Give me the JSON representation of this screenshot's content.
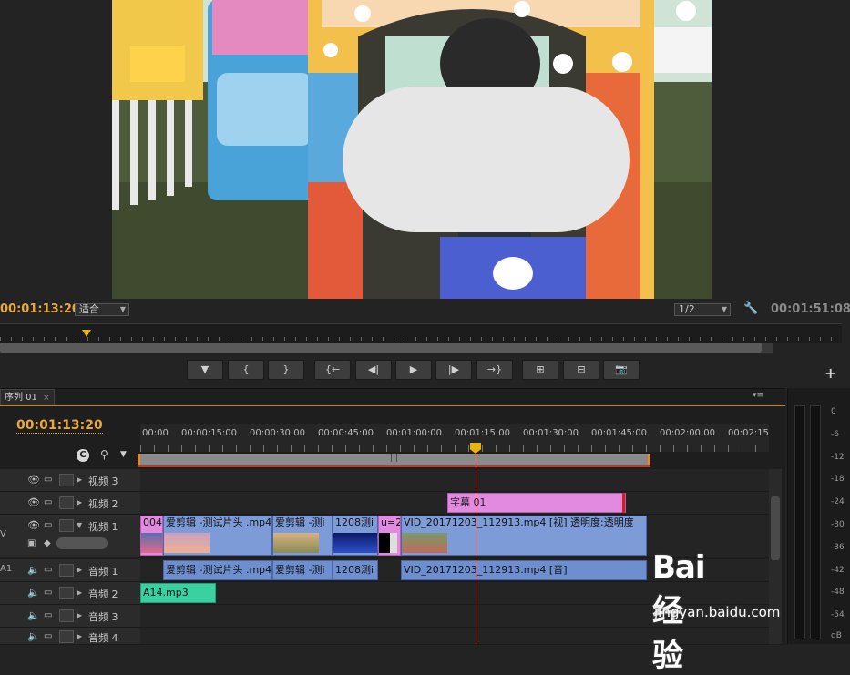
{
  "monitor": {
    "current_timecode": "00:01:13:20",
    "fit_select": "适合",
    "resolution_select": "1/2",
    "duration_timecode": "00:01:51:08"
  },
  "transport": {
    "buttons": [
      "▼",
      "{",
      "}",
      "{←",
      "◀|",
      "▶",
      "|▶",
      "→}",
      "⊞",
      "⊟",
      "📷"
    ]
  },
  "timeline": {
    "tab_label": "序列 01",
    "tab_close": "×",
    "menu_glyph": "▾≡",
    "timecode": "00:01:13:20",
    "ruler_ticks": [
      "00:00",
      "00:00:15:00",
      "00:00:30:00",
      "00:00:45:00",
      "00:01:00:00",
      "00:01:15:00",
      "00:01:30:00",
      "00:01:45:00",
      "00:02:00:00",
      "00:02:15"
    ],
    "work_bar_grip": "|||",
    "side_label_v": "V",
    "side_label_a": "A1",
    "tracks": {
      "video3": "视频 3",
      "video2": "视频 2",
      "video1": "视频 1",
      "audio1": "音频 1",
      "audio2": "音频 2",
      "audio3": "音频 3",
      "audio4": "音频 4"
    },
    "clips": {
      "title": "字幕 01",
      "v_004": "004",
      "v_aijianji_1": "爱剪辑 -测试片头 .mp4",
      "v_aijianji_2": "爱剪辑 -测i",
      "v_1208": "1208测i",
      "v_u2": "u=2",
      "v_vid": "VID_20171203_112913.mp4 [视] 透明度:透明度",
      "a_aijianji_1": "爱剪辑 -测试片头 .mp4",
      "a_aijianji_2": "爱剪辑 -测i",
      "a_1208": "1208测i",
      "a_vid": "VID_20171203_112913.mp4 [音]",
      "a_a14": "A14.mp3"
    }
  },
  "meter": {
    "db_labels": [
      "0",
      "-6",
      "-12",
      "-18",
      "-24",
      "-30",
      "-36",
      "-42",
      "-48",
      "-54",
      "dB"
    ]
  },
  "watermark": {
    "logo": "Bai 经验",
    "url": "jingyan.baidu.com"
  },
  "colors": {
    "timecode_orange": "#e8a83a",
    "video_clip": "#7d9bd6",
    "title_clip": "#e28ae0",
    "audio_clip_green": "#3ad1a0",
    "playhead": "#e8b40e"
  }
}
